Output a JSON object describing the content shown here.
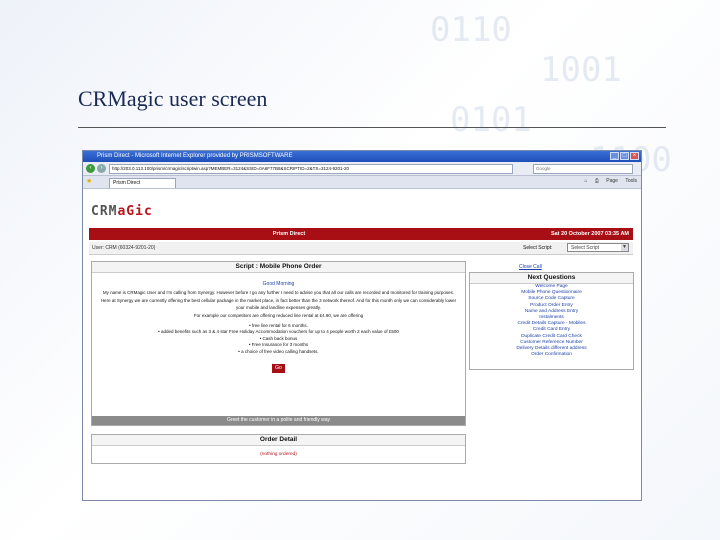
{
  "slide": {
    "title": "CRMagic user screen"
  },
  "browser": {
    "window_title": "Prism Direct - Microsoft Internet Explorer provided by PRISMSOFTWARE",
    "address": "http://203.0.113.100/prism/crmagic/scriptwin.asp?MEMBER=3124&SSID=0A6F77B8&SCRIPTID=2&TS=3124-9201-20",
    "search_placeholder": "Google",
    "tab_label": "Prism Direct",
    "tools": {
      "page": "Page",
      "tools": "Tools"
    }
  },
  "app": {
    "logo_text": "CRM",
    "logo_accent": "aGic",
    "banner_title": "Prism Direct",
    "banner_date": "Sat 20 October 2007 03:35 AM",
    "user_line": "User: CRM (60324-9201-20)",
    "select_script_label": "Select Script:",
    "select_script_value": "Select Script"
  },
  "script": {
    "header": "Script : Mobile Phone Order",
    "greeting": "Good Morning",
    "para1": "My name is CRMagic User and I'm calling from Synergy. However before I go any further I need to advise you that all our calls are recorded and monitored for training purposes.",
    "para2": "Here at Synergy we are currently offering the best cellular package in the market place, in fact better than the 3 network thereof. And for this month only we can considerably lower your mobile and landline expenses greatly.",
    "para3": "For example our competitors are offering reduced line rental at £4.90, we are offering",
    "bullets": [
      "free line rental for 6 months.",
      "added benefits such as 3 & 4 star Free Holiday Accommodation vouchers for up to 4 people worth 2 each value of £500",
      "Cash back bonus",
      "Free Insurance for 3 months",
      "a choice of free video calling handsets."
    ],
    "go_label": "Go",
    "footer": "Greet the customer in a polite and friendly way"
  },
  "next_questions": {
    "close_call": "Close Call",
    "header": "Next Questions",
    "items": [
      "Welcome Page",
      "Mobile Phone Questionnaire",
      "Source Code Capture",
      "Product Order Entry",
      "Name and Address Entry",
      "Instalments",
      "Credit Details Capture - Mobiles",
      "Credit Card Entry",
      "Duplicate Credit Card Check",
      "Customer Reference Number",
      "Delivery Details different address",
      "Order Confirmation"
    ]
  },
  "order": {
    "header": "Order Detail",
    "empty": "(nothing ordered)"
  }
}
